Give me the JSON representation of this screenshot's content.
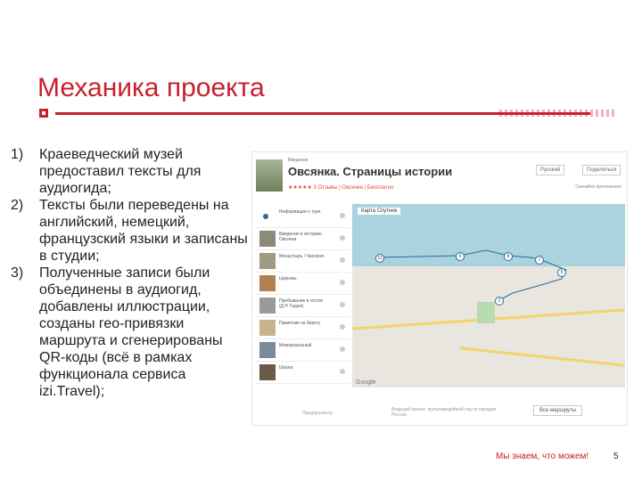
{
  "slide": {
    "title": "Механика проекта",
    "items": [
      "Краеведческий музей предоставил тексты для аудиогида;",
      "Тексты были переведены на английский, немецкий, французский языки и записаны в студии;",
      " Полученные записи были объединены в аудиогид, добавлены иллюстрации, созданы гео-привязки маршрута и сгенерированы QR-коды (всё в рамках функционала сервиса izi.Travel);"
    ],
    "numbers": [
      "1)",
      "2)",
      "3)"
    ],
    "slogan": "Мы знаем, что можем!",
    "page": "5"
  },
  "screenshot": {
    "crumb": "Введение",
    "place": "Овсянка. Страницы истории",
    "rating": "★★★★★ 3 Отзывы  |  Овсянка  |  Бесплатно",
    "lang": "Русский",
    "share": "Поделиться",
    "store": "Скачайте приложение",
    "map_tabs": "Карта   Спутник",
    "side_items": [
      "Информация о туре",
      "Введение в историю Овсянки",
      "Монастырь / Часовня",
      "Церковь",
      "Пребывание в гостях (Д.Р. Гадюк)",
      "Памятник на берегу",
      "Мемориальный",
      "Школа"
    ],
    "google": "Google",
    "footer_left": "Предпросмотр",
    "footer_mid": "Ведущий проект: мультимедийный гид по городам России",
    "footer_btn": "Все маршруты"
  },
  "colors": {
    "accent": "#c8202f"
  }
}
